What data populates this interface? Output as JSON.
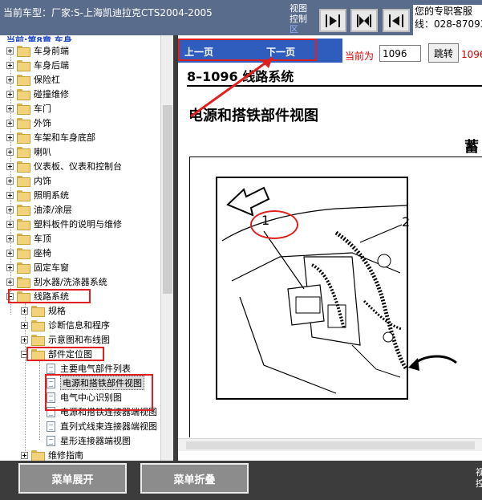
{
  "header": {
    "title": "当前车型：厂家:S-上海凯迪拉克CTS2004-2005",
    "view_control": [
      "视图",
      "控制",
      "区"
    ],
    "service": [
      "您的专职客服",
      "线：028-87093"
    ]
  },
  "tree": {
    "title": "当前:第8章 车身",
    "items": [
      {
        "label": "车身前端"
      },
      {
        "label": "车身后端"
      },
      {
        "label": "保险杠"
      },
      {
        "label": "碰撞维修"
      },
      {
        "label": "车门"
      },
      {
        "label": "外饰"
      },
      {
        "label": "车架和车身底部"
      },
      {
        "label": "喇叭"
      },
      {
        "label": "仪表板、仪表和控制台"
      },
      {
        "label": "内饰"
      },
      {
        "label": "照明系统"
      },
      {
        "label": "油漆/涂层"
      },
      {
        "label": "塑料板件的说明与维修"
      },
      {
        "label": "车顶"
      },
      {
        "label": "座椅"
      },
      {
        "label": "固定车窗"
      },
      {
        "label": "刮水器/洗涤器系统"
      },
      {
        "label": "线路系统"
      },
      {
        "label": "规格"
      },
      {
        "label": "诊断信息和程序"
      },
      {
        "label": "示意图和布线图"
      },
      {
        "label": "部件定位图"
      },
      {
        "label": "主要电气部件列表"
      },
      {
        "label": "电源和搭铁部件视图"
      },
      {
        "label": "电气中心识别图"
      },
      {
        "label": "电源和搭铁连接器端视图"
      },
      {
        "label": "直列式线束连接器端视图"
      },
      {
        "label": "星形连接器端视图"
      },
      {
        "label": "维修指南"
      }
    ]
  },
  "content": {
    "prev_label": "上一页",
    "next_label": "下一页",
    "current_label": "当前为",
    "page_value": "1096",
    "jump_label": "跳转",
    "total": "1096",
    "section_header": "8–1096  线路系统",
    "view_title": "电源和搭铁部件视图",
    "partial_heading": "蓄",
    "callout_1": "1",
    "callout_2": "2"
  },
  "bottom": {
    "expand_label": "菜单展开",
    "collapse_label": "菜单折叠",
    "right_text": [
      "视",
      "控"
    ]
  },
  "colors": {
    "accent_blue": "#2e5dbe",
    "alert_red": "#d30000",
    "highlight_red": "#e0201e"
  }
}
